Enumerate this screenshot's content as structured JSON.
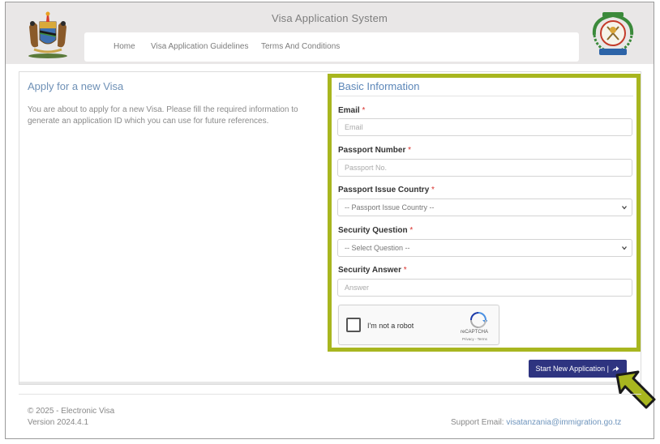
{
  "header": {
    "title": "Visa Application System",
    "nav": [
      {
        "label": "Home"
      },
      {
        "label": "Visa Application Guidelines"
      },
      {
        "label": "Terms And Conditions"
      }
    ]
  },
  "intro": {
    "title": "Apply for a new Visa",
    "description": "You are about to apply for a new Visa. Please fill the required information to generate an application ID which you can use for future references."
  },
  "form": {
    "title": "Basic Information",
    "required_marker": "*",
    "email": {
      "label": "Email",
      "placeholder": "Email",
      "value": ""
    },
    "passport_number": {
      "label": "Passport Number",
      "placeholder": "Passport No.",
      "value": ""
    },
    "passport_country": {
      "label": "Passport Issue Country",
      "selected": "-- Passport Issue Country --"
    },
    "security_question": {
      "label": "Security Question",
      "selected": "-- Select Question --"
    },
    "security_answer": {
      "label": "Security Answer",
      "placeholder": "Answer",
      "value": ""
    },
    "recaptcha": {
      "label": "I'm not a robot",
      "brand": "reCAPTCHA",
      "terms": "Privacy - Terms"
    },
    "submit_label": "Start New Application |"
  },
  "footer": {
    "copyright": "© 2025 - Electronic Visa",
    "version": "Version 2024.4.1",
    "support_label": "Support Email:",
    "support_email": "visatanzania@immigration.go.tz"
  },
  "colors": {
    "accent_highlight": "#a8b61f",
    "button_bg": "#2e3480",
    "title_blue": "#5b86b8",
    "required_red": "#d9302c",
    "arrow_green": "#a8b61f"
  },
  "icons": [
    "coat-of-arms-icon",
    "immigration-emblem-icon",
    "share-arrow-icon",
    "chevron-down-icon",
    "recaptcha-logo-icon",
    "pointer-arrow-icon"
  ]
}
